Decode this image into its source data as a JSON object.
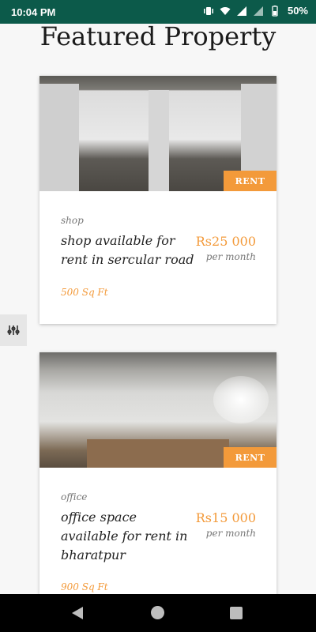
{
  "status_bar": {
    "time": "10:04 PM",
    "battery_percent": "50%",
    "icons": [
      "vibrate-icon",
      "wifi-icon",
      "signal-icon",
      "signal-icon",
      "battery-icon"
    ]
  },
  "header": {
    "title": "Featured Property"
  },
  "listings": [
    {
      "badge": "RENT",
      "category": "shop",
      "title": "shop available for rent in sercular road",
      "price": "Rs25 000",
      "period": "per month",
      "area": "500 Sq Ft"
    },
    {
      "badge": "RENT",
      "category": "office",
      "title": "office space available for rent in bharatpur",
      "price": "Rs15 000",
      "period": "per month",
      "area": "900 Sq Ft"
    }
  ],
  "colors": {
    "status_bar": "#0c5a4a",
    "accent": "#f39a3a",
    "background": "#f7f7f7"
  },
  "navigation": {
    "buttons": [
      "back-icon",
      "home-icon",
      "recents-icon"
    ]
  }
}
